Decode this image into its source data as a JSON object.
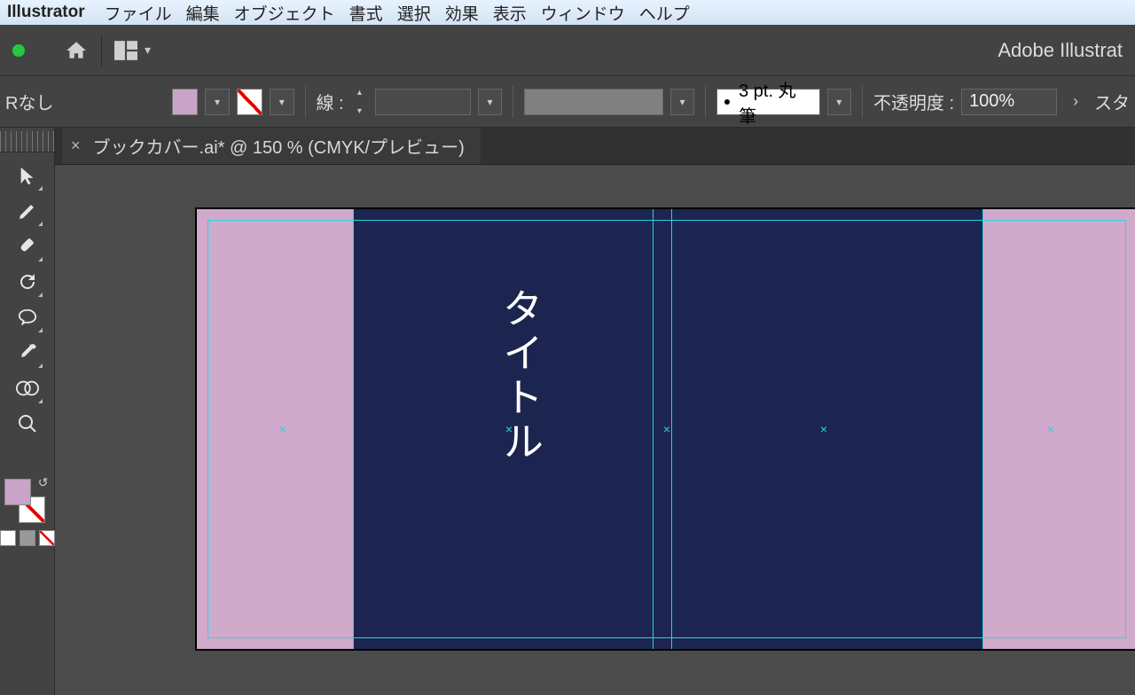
{
  "menubar": {
    "app_name": "Illustrator",
    "items": [
      "ファイル",
      "編集",
      "オブジェクト",
      "書式",
      "選択",
      "効果",
      "表示",
      "ウィンドウ",
      "ヘルプ"
    ]
  },
  "appbar": {
    "app_label": "Adobe Illustrat"
  },
  "controlbar": {
    "left_label": "Rなし",
    "stroke_label": "線 :",
    "brush_text": "3 pt. 丸筆",
    "opacity_label": "不透明度 :",
    "opacity_value": "100%",
    "right_label": "スタ"
  },
  "tab": {
    "title": "ブックカバー.ai* @ 150 % (CMYK/プレビュー)"
  },
  "artboard": {
    "title_text": "タイトル"
  },
  "colors": {
    "pink": "#d0aacb",
    "navy": "#1b2550",
    "cyan": "#29d3e0"
  }
}
